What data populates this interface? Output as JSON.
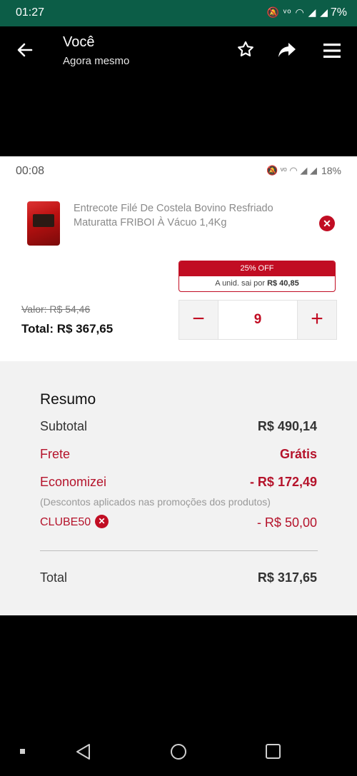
{
  "outer_status": {
    "time": "01:27",
    "battery": "7%"
  },
  "viewer": {
    "title": "Você",
    "subtitle": "Agora mesmo"
  },
  "inner_status": {
    "time": "00:08",
    "battery": "18%"
  },
  "product": {
    "name": "Entrecote Filé De Costela Bovino Resfriado Maturatta FRIBOI À Vácuo 1,4Kg",
    "promo_off": "25% OFF",
    "promo_unit_prefix": "A unid. sai por",
    "promo_unit_price": "R$ 40,85",
    "old_price": "Valor: R$ 54,46",
    "total": "Total: R$ 367,65",
    "quantity": "9",
    "minus": "−",
    "plus": "+"
  },
  "summary": {
    "title": "Resumo",
    "subtotal_label": "Subtotal",
    "subtotal_value": "R$ 490,14",
    "frete_label": "Frete",
    "frete_value": "Grátis",
    "economizei_label": "Economizei",
    "economizei_value": "- R$ 172,49",
    "note": "(Descontos aplicados nas promoções dos produtos)",
    "coupon_code": "CLUBE50",
    "coupon_value": "- R$ 50,00",
    "total_label": "Total",
    "total_value": "R$ 317,65"
  },
  "colors": {
    "accent": "#c10d23",
    "status_green": "#0c5d47"
  }
}
